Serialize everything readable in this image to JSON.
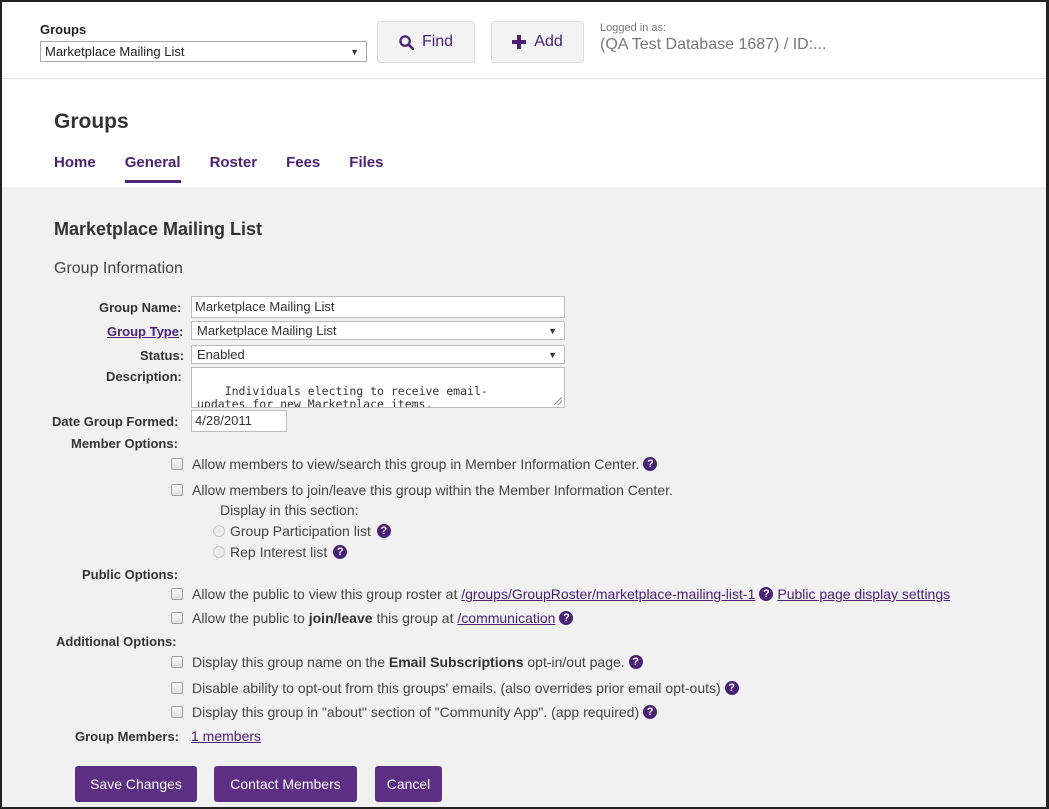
{
  "topbar": {
    "group_label": "Groups",
    "group_selected": "Marketplace Mailing List",
    "find_label": "Find",
    "add_label": "Add",
    "logged_label": "Logged in as:",
    "logged_user": "(QA Test Database 1687) / ID:..."
  },
  "header": {
    "title": "Groups",
    "tabs": [
      "Home",
      "General",
      "Roster",
      "Fees",
      "Files"
    ],
    "active_tab": "General"
  },
  "content": {
    "title": "Marketplace Mailing List",
    "subtitle": "Group Information"
  },
  "form": {
    "group_name_label": "Group Name:",
    "group_name_value": "Marketplace Mailing List",
    "group_type_label": "Group Type",
    "group_type_colon": ":",
    "group_type_value": "Marketplace Mailing List",
    "status_label": "Status:",
    "status_value": "Enabled",
    "description_label": "Description:",
    "description_value": "Individuals electing to receive email-\nupdates for new Marketplace items.",
    "date_label": "Date Group Formed:",
    "date_value": "4/28/2011",
    "member_options_label": "Member Options:",
    "public_options_label": "Public Options:",
    "additional_options_label": "Additional Options:",
    "group_members_label": "Group Members:",
    "group_members_link": "1 members"
  },
  "member_options": {
    "view_search": "Allow members to view/search this group in Member Information Center.",
    "join_leave": "Allow members to join/leave this group within the Member Information Center.",
    "display_in": "Display in this section:",
    "participation": "Group Participation list",
    "rep_interest": "Rep Interest list"
  },
  "public_options": {
    "view_prefix": "Allow the public to view this group roster at ",
    "roster_link": "/groups/GroupRoster/marketplace-mailing-list-1",
    "display_settings_link": "Public page display settings",
    "join_prefix": "Allow the public to ",
    "join_bold": "join/leave",
    "join_middle": " this group at ",
    "communication_link": "/communication"
  },
  "additional_options": {
    "email_prefix": "Display this group name on the ",
    "email_bold": "Email Subscriptions",
    "email_suffix": " opt-in/out page.",
    "disable_optout": "Disable ability to opt-out from this groups' emails. (also overrides prior email opt-outs)",
    "community_app": "Display this group in \"about\" section of \"Community App\". (app required)"
  },
  "actions": {
    "save": "Save Changes",
    "contact": "Contact Members",
    "cancel": "Cancel"
  },
  "colors": {
    "accent": "#4a2276",
    "button": "#5c2e84",
    "content_bg": "#f1f1f1"
  }
}
